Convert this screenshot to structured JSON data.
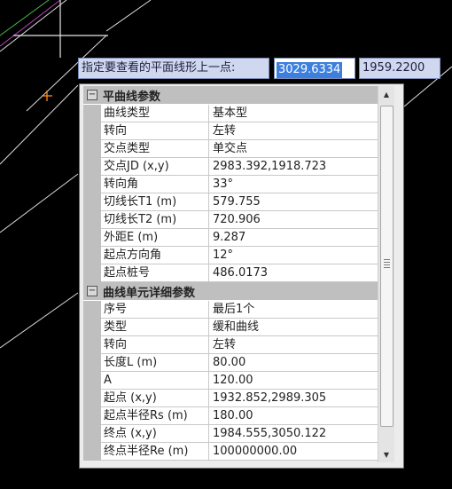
{
  "input_bar": {
    "prompt": "指定要查看的平面线形上一点:",
    "x_value": "3029.6334",
    "y_value": "1959.2200"
  },
  "panel": {
    "sections": [
      {
        "title": "平曲线参数",
        "toggle": "−",
        "rows": [
          {
            "name": "曲线类型",
            "value": "基本型"
          },
          {
            "name": "转向",
            "value": "左转"
          },
          {
            "name": "交点类型",
            "value": "单交点"
          },
          {
            "name": "交点JD (x,y)",
            "value": "2983.392,1918.723"
          },
          {
            "name": "转向角",
            "value": "33°"
          },
          {
            "name": "切线长T1 (m)",
            "value": "579.755"
          },
          {
            "name": "切线长T2 (m)",
            "value": "720.906"
          },
          {
            "name": "外距E (m)",
            "value": "9.287"
          },
          {
            "name": "起点方向角",
            "value": "12°"
          },
          {
            "name": "起点桩号",
            "value": "486.0173"
          }
        ]
      },
      {
        "title": "曲线单元详细参数",
        "toggle": "−",
        "rows": [
          {
            "name": "序号",
            "value": "最后1个"
          },
          {
            "name": "类型",
            "value": "缓和曲线"
          },
          {
            "name": "转向",
            "value": "左转"
          },
          {
            "name": "长度L (m)",
            "value": "80.00"
          },
          {
            "name": "A",
            "value": "120.00"
          },
          {
            "name": "起点 (x,y)",
            "value": "1932.852,2989.305"
          },
          {
            "name": "起点半径Rs (m)",
            "value": "180.00"
          },
          {
            "name": "终点 (x,y)",
            "value": "1984.555,3050.122"
          },
          {
            "name": "终点半径Re (m)",
            "value": "100000000.00"
          }
        ]
      }
    ]
  },
  "colors": {
    "background": "#000000",
    "selection": "#3c7fde",
    "crosshair": "#e8e8e8",
    "marker": "#ff8c1a",
    "alignment_green": "#4db84d",
    "alignment_magenta": "#c040c0"
  },
  "icons": {
    "collapse": "minus-box-icon",
    "scroll_up": "triangle-up",
    "scroll_down": "triangle-down"
  }
}
